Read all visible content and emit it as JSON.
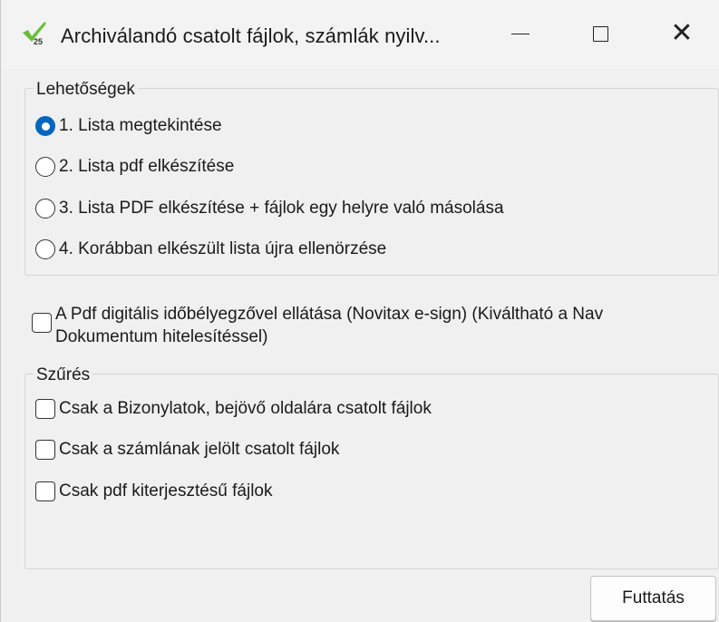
{
  "window": {
    "title": "Archiválandó csatolt fájlok, számlák nyilv...",
    "controls": {
      "minimize": "minimize-icon",
      "maximize": "maximize-icon",
      "close": "close-icon"
    }
  },
  "options": {
    "legend": "Lehetőségek",
    "items": [
      {
        "label": "1. Lista megtekintése",
        "selected": true
      },
      {
        "label": "2. Lista pdf elkészítése",
        "selected": false
      },
      {
        "label": "3. Lista PDF elkészítése + fájlok egy helyre való másolása",
        "selected": false
      },
      {
        "label": "4. Korábban elkészült lista újra ellenörzése",
        "selected": false
      }
    ]
  },
  "timestamp_option": {
    "line1": "A Pdf digitális időbélyegzővel ellátása (Novitax e-sign) (Kiváltható a Nav",
    "line2": "Dokumentum hitelesítéssel)",
    "checked": false
  },
  "filter": {
    "legend": "Szűrés",
    "items": [
      {
        "label": "Csak a Bizonylatok, bejövő oldalára csatolt fájlok",
        "checked": false
      },
      {
        "label": "Csak a számlának jelölt csatolt fájlok",
        "checked": false
      },
      {
        "label": "Csak pdf kiterjesztésű fájlok",
        "checked": false
      }
    ]
  },
  "actions": {
    "run_label": "Futtatás"
  },
  "colors": {
    "accent": "#0067c0",
    "icon_green": "#6abf3a"
  }
}
